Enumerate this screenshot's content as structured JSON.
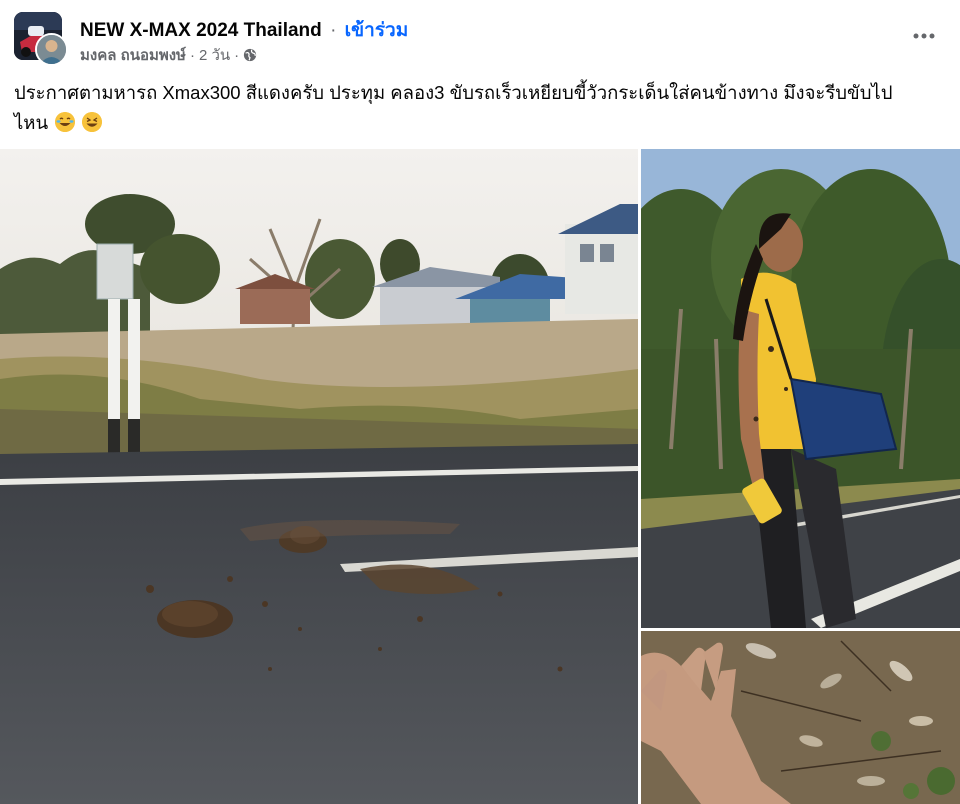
{
  "post": {
    "group_name": "NEW X-MAX 2024 Thailand",
    "separator": "·",
    "join_label": "เข้าร่วม",
    "author": "มงคล ถนอมพงษ์",
    "time": "2 วัน",
    "privacy_icon": "globe-icon",
    "more_icon": "more-icon",
    "text_line1": "ประกาศตามหารถ Xmax300 สีแดงครับ ประทุม คลอง3 ขับรถเร็วเหยียบขี้วัวกระเด็นใส่คนข้างทาง มึงจะรีบขับไป",
    "text_line2": "ไหน",
    "emojis": [
      "joy-emoji",
      "laughing-emoji"
    ]
  },
  "photos": [
    {
      "name": "road-with-cow-dung-photo"
    },
    {
      "name": "woman-in-yellow-shirt-photo"
    },
    {
      "name": "hand-over-ground-photo"
    }
  ],
  "colors": {
    "link_blue": "#0866ff",
    "secondary_text": "#65676b",
    "primary_text": "#050505"
  }
}
